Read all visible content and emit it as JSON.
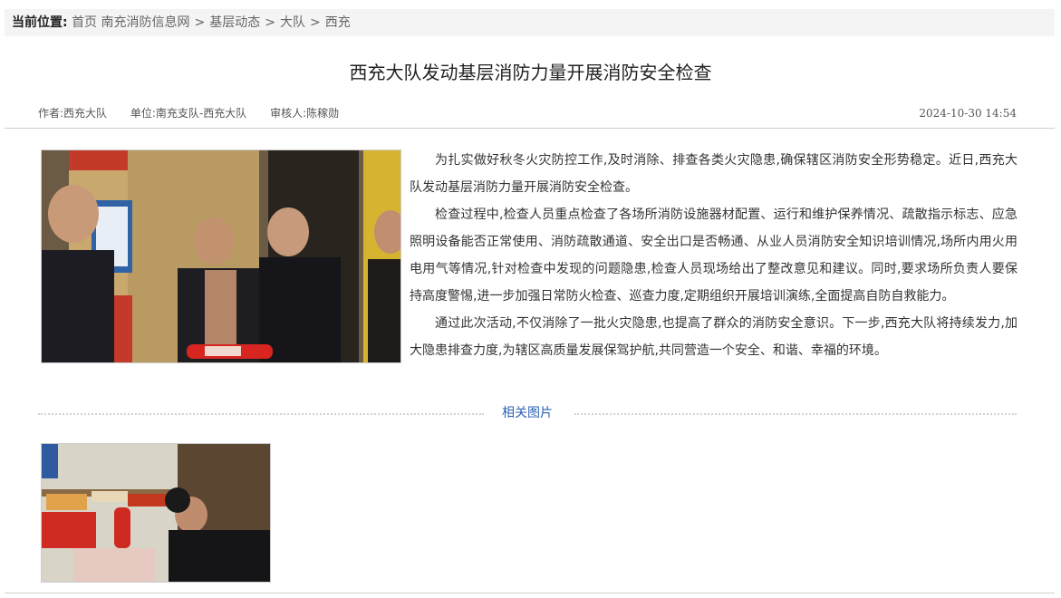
{
  "breadcrumb": {
    "lead": "当前位置:",
    "items": [
      "首页 南充消防信息网",
      "基层动态",
      "大队",
      "西充"
    ],
    "separator": ">"
  },
  "article": {
    "title": "西充大队发动基层消防力量开展消防安全检查",
    "meta": {
      "author": "作者:西充大队",
      "unit": "单位:南充支队-西充大队",
      "reviewer": "审核人:陈稼勋",
      "datetime": "2024-10-30 14:54"
    },
    "paragraphs": [
      "为扎实做好秋冬火灾防控工作,及时消除、排查各类火灾隐患,确保辖区消防安全形势稳定。近日,西充大队发动基层消防力量开展消防安全检查。",
      "检查过程中,检查人员重点检查了各场所消防设施器材配置、运行和维护保养情况、疏散指示标志、应急照明设备能否正常使用、消防疏散通道、安全出口是否畅通、从业人员消防安全知识培训情况,场所内用火用电用气等情况,针对检查中发现的问题隐患,检查人员现场给出了整改意见和建议。同时,要求场所负责人要保持高度警惕,进一步加强日常防火检查、巡查力度,定期组织开展培训演练,全面提高自防自救能力。",
      "通过此次活动,不仅消除了一批火灾隐患,也提高了群众的消防安全意识。下一步,西充大队将持续发力,加大隐患排查力度,为辖区高质量发展保驾护航,共同营造一个安全、和谐、幸福的环境。"
    ]
  },
  "related": {
    "label": "相关图片"
  },
  "colors": {
    "link_blue": "#2a62b5",
    "breadcrumb_bg": "#f4f4f4",
    "rule": "#cfcfcf"
  }
}
